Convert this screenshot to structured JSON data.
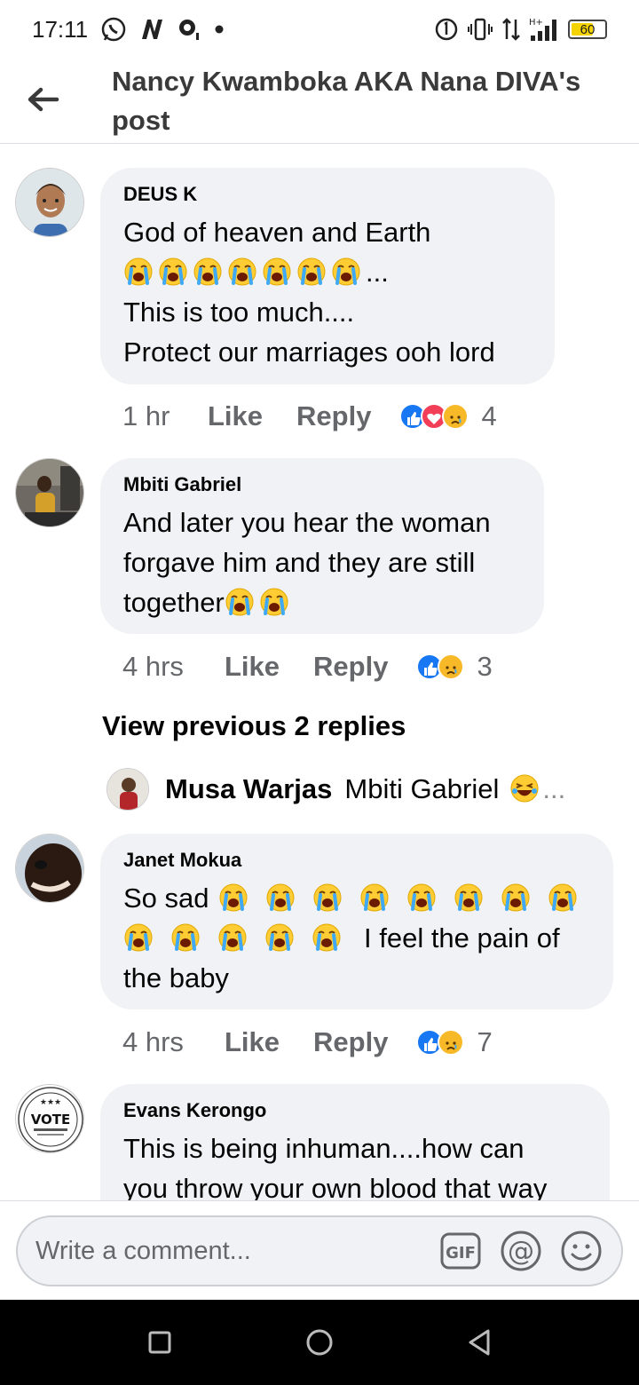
{
  "status_bar": {
    "time": "17:11",
    "battery": "60"
  },
  "header": {
    "title": "Nancy Kwamboka AKA Nana DIVA's post"
  },
  "comments": [
    {
      "author": "DEUS K",
      "line1": "God of heaven and Earth",
      "line2_emoji_count": 7,
      "line2_suffix": "...",
      "line3": "This is too much....",
      "line4": "Protect our marriages ooh lord",
      "time": "1 hr",
      "like": "Like",
      "reply": "Reply",
      "reactions": [
        "like",
        "love",
        "sad"
      ],
      "reaction_count": "4"
    },
    {
      "author": "Mbiti Gabriel",
      "line1": "And later you hear the woman",
      "line2": "forgave him and they are still",
      "line3": "together",
      "time": "4 hrs",
      "like": "Like",
      "reply": "Reply",
      "reactions": [
        "like",
        "sad"
      ],
      "reaction_count": "3"
    },
    {
      "author": "Janet Mokua",
      "line1": "So sad",
      "line2_text": "I feel the pain of",
      "line3": "the baby",
      "time": "4 hrs",
      "like": "Like",
      "reply": "Reply",
      "reactions": [
        "like",
        "sad"
      ],
      "reaction_count": "7"
    },
    {
      "author": "Evans Kerongo",
      "line1": "This is being inhuman....how can",
      "line2": "you throw your own blood that way"
    }
  ],
  "view_previous": "View previous 2 replies",
  "reply_preview": {
    "author": "Musa Warjas",
    "text": "Mbiti Gabriel",
    "ellipsis": "..."
  },
  "evans_avatar_text": "VOTE",
  "composer": {
    "placeholder": "Write a comment..."
  },
  "colors": {
    "bubble": "#f0f2f5",
    "like_blue": "#1877f2",
    "love_red": "#f33e58",
    "sad_yellow": "#f7b928",
    "muted": "#65676b"
  }
}
